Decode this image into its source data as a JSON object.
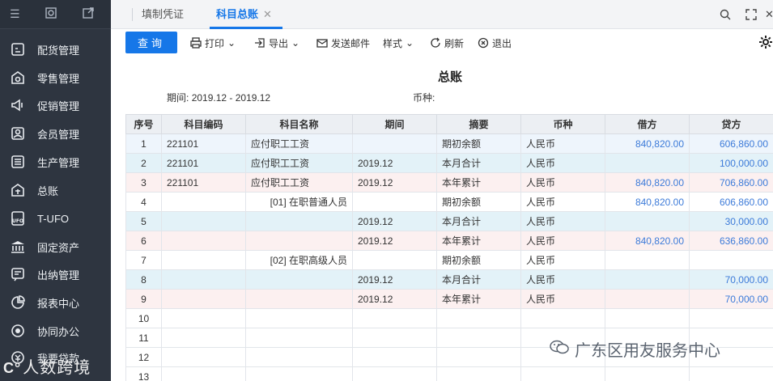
{
  "sidebar": {
    "items": [
      {
        "label": "配货管理",
        "icon": "distribution-icon"
      },
      {
        "label": "零售管理",
        "icon": "retail-icon"
      },
      {
        "label": "促销管理",
        "icon": "megaphone-icon"
      },
      {
        "label": "会员管理",
        "icon": "member-icon"
      },
      {
        "label": "生产管理",
        "icon": "production-icon"
      },
      {
        "label": "总账",
        "icon": "ledger-icon"
      },
      {
        "label": "T-UFO",
        "icon": "ufo-icon"
      },
      {
        "label": "固定资产",
        "icon": "bank-icon"
      },
      {
        "label": "出纳管理",
        "icon": "cashier-icon"
      },
      {
        "label": "报表中心",
        "icon": "pie-chart-icon"
      },
      {
        "label": "协同办公",
        "icon": "target-icon"
      },
      {
        "label": "我要贷款",
        "icon": "loan-icon"
      }
    ],
    "watermark": "人数跨境"
  },
  "tabs": {
    "voucher": "填制凭证",
    "ledger": "科目总账",
    "close": "✕"
  },
  "toolbar": {
    "query": "查询",
    "print": "打印",
    "export": "导出",
    "email": "发送邮件",
    "style": "样式",
    "refresh": "刷新",
    "exit": "退出"
  },
  "report": {
    "title": "总账",
    "period_label": "期间:",
    "period_value": "2019.12 - 2019.12",
    "currency_label": "币种:"
  },
  "table": {
    "headers": [
      "序号",
      "科目编码",
      "科目名称",
      "期间",
      "摘要",
      "币种",
      "借方",
      "贷方"
    ],
    "rows": [
      {
        "idx": "1",
        "code": "221101",
        "name": "应付职工工资",
        "period": "",
        "summary": "期初余额",
        "currency": "人民币",
        "debit": "840,820.00",
        "credit": "606,860.00",
        "bg": "bg-blue"
      },
      {
        "idx": "2",
        "code": "221101",
        "name": "应付职工工资",
        "period": "2019.12",
        "summary": "本月合计",
        "currency": "人民币",
        "debit": "",
        "credit": "100,000.00",
        "bg": "bg-cyan"
      },
      {
        "idx": "3",
        "code": "221101",
        "name": "应付职工工资",
        "period": "2019.12",
        "summary": "本年累计",
        "currency": "人民币",
        "debit": "840,820.00",
        "credit": "706,860.00",
        "bg": "bg-pink"
      },
      {
        "idx": "4",
        "code": "",
        "name": "[01] 在职普通人员",
        "period": "",
        "summary": "期初余额",
        "currency": "人民币",
        "debit": "840,820.00",
        "credit": "606,860.00",
        "bg": "bg-white",
        "indent": true
      },
      {
        "idx": "5",
        "code": "",
        "name": "",
        "period": "2019.12",
        "summary": "本月合计",
        "currency": "人民币",
        "debit": "",
        "credit": "30,000.00",
        "bg": "bg-cyan"
      },
      {
        "idx": "6",
        "code": "",
        "name": "",
        "period": "2019.12",
        "summary": "本年累计",
        "currency": "人民币",
        "debit": "840,820.00",
        "credit": "636,860.00",
        "bg": "bg-pink"
      },
      {
        "idx": "7",
        "code": "",
        "name": "[02] 在职高级人员",
        "period": "",
        "summary": "期初余额",
        "currency": "人民币",
        "debit": "",
        "credit": "",
        "bg": "bg-white",
        "indent": true
      },
      {
        "idx": "8",
        "code": "",
        "name": "",
        "period": "2019.12",
        "summary": "本月合计",
        "currency": "人民币",
        "debit": "",
        "credit": "70,000.00",
        "bg": "bg-cyan"
      },
      {
        "idx": "9",
        "code": "",
        "name": "",
        "period": "2019.12",
        "summary": "本年累计",
        "currency": "人民币",
        "debit": "",
        "credit": "70,000.00",
        "bg": "bg-pink"
      },
      {
        "idx": "10",
        "code": "",
        "name": "",
        "period": "",
        "summary": "",
        "currency": "",
        "debit": "",
        "credit": "",
        "bg": "bg-white"
      },
      {
        "idx": "11",
        "code": "",
        "name": "",
        "period": "",
        "summary": "",
        "currency": "",
        "debit": "",
        "credit": "",
        "bg": "bg-white"
      },
      {
        "idx": "12",
        "code": "",
        "name": "",
        "period": "",
        "summary": "",
        "currency": "",
        "debit": "",
        "credit": "",
        "bg": "bg-white"
      },
      {
        "idx": "13",
        "code": "",
        "name": "",
        "period": "",
        "summary": "",
        "currency": "",
        "debit": "",
        "credit": "",
        "bg": "bg-white"
      }
    ]
  },
  "watermark": {
    "text": "广东区用友服务中心"
  },
  "colors": {
    "sidebar_bg": "#2e3540",
    "accent": "#1677e8",
    "amount_blue": "#3d7bd9"
  }
}
